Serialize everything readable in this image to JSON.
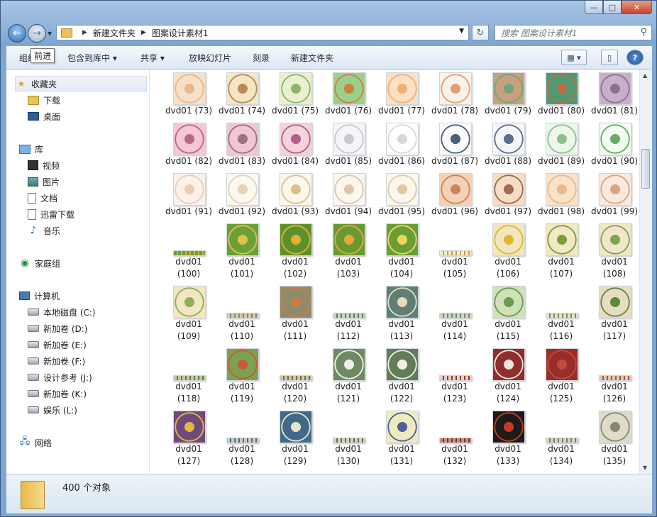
{
  "window": {
    "min_glyph": "—",
    "max_glyph": "□",
    "close_glyph": "✕"
  },
  "nav": {
    "back_glyph": "←",
    "forward_glyph": "→",
    "dropdown_glyph": "▼",
    "breadcrumb": [
      "新建文件夹",
      "图案设计素材1"
    ],
    "refresh_glyph": "↻",
    "search_placeholder": "搜索 图案设计素材1",
    "tooltip": "前进"
  },
  "toolbar": {
    "organize": "组织",
    "include": "包含到库中 ▾",
    "share": "共享 ▾",
    "slideshow": "放映幻灯片",
    "burn": "刻录",
    "new_folder": "新建文件夹"
  },
  "sidebar": {
    "favorites": {
      "label": "收藏夹",
      "items": [
        "下载",
        "桌面"
      ]
    },
    "libraries": {
      "label": "库",
      "items": [
        "视频",
        "图片",
        "文档",
        "迅雷下载",
        "音乐"
      ]
    },
    "homegroup": "家庭组",
    "computer": {
      "label": "计算机",
      "items": [
        "本地磁盘 (C:)",
        "新加卷 (D:)",
        "新加卷 (E:)",
        "新加卷 (F:)",
        "设计参考 (J:)",
        "新加卷 (K:)",
        "娱乐 (L:)"
      ]
    },
    "network": "网络"
  },
  "files": {
    "row1": [
      "dvd01 (73)",
      "dvd01 (74)",
      "dvd01 (75)",
      "dvd01 (76)",
      "dvd01 (77)",
      "dvd01 (78)",
      "dvd01 (79)",
      "dvd01 (80)",
      "dvd01 (81)"
    ],
    "row2": [
      "dvd01 (82)",
      "dvd01 (83)",
      "dvd01 (84)",
      "dvd01 (85)",
      "dvd01 (86)",
      "dvd01 (87)",
      "dvd01 (88)",
      "dvd01 (89)",
      "dvd01 (90)"
    ],
    "row3": [
      "dvd01 (91)",
      "dvd01 (92)",
      "dvd01 (93)",
      "dvd01 (94)",
      "dvd01 (95)",
      "dvd01 (96)",
      "dvd01 (97)",
      "dvd01 (98)",
      "dvd01 (99)"
    ],
    "row4": [
      [
        "dvd01",
        "(100)"
      ],
      [
        "dvd01",
        "(101)"
      ],
      [
        "dvd01",
        "(102)"
      ],
      [
        "dvd01",
        "(103)"
      ],
      [
        "dvd01",
        "(104)"
      ],
      [
        "dvd01",
        "(105)"
      ],
      [
        "dvd01",
        "(106)"
      ],
      [
        "dvd01",
        "(107)"
      ],
      [
        "dvd01",
        "(108)"
      ]
    ],
    "row5": [
      [
        "dvd01",
        "(109)"
      ],
      [
        "dvd01",
        "(110)"
      ],
      [
        "dvd01",
        "(111)"
      ],
      [
        "dvd01",
        "(112)"
      ],
      [
        "dvd01",
        "(113)"
      ],
      [
        "dvd01",
        "(114)"
      ],
      [
        "dvd01",
        "(115)"
      ],
      [
        "dvd01",
        "(116)"
      ],
      [
        "dvd01",
        "(117)"
      ]
    ],
    "row6": [
      [
        "dvd01",
        "(118)"
      ],
      [
        "dvd01",
        "(119)"
      ],
      [
        "dvd01",
        "(120)"
      ],
      [
        "dvd01",
        "(121)"
      ],
      [
        "dvd01",
        "(122)"
      ],
      [
        "dvd01",
        "(123)"
      ],
      [
        "dvd01",
        "(124)"
      ],
      [
        "dvd01",
        "(125)"
      ],
      [
        "dvd01",
        "(126)"
      ]
    ],
    "row7": [
      [
        "dvd01",
        "(127)"
      ],
      [
        "dvd01",
        "(128)"
      ],
      [
        "dvd01",
        "(129)"
      ],
      [
        "dvd01",
        "(130)"
      ],
      [
        "dvd01",
        "(131)"
      ],
      [
        "dvd01",
        "(132)"
      ],
      [
        "dvd01",
        "(133)"
      ],
      [
        "dvd01",
        "(134)"
      ],
      [
        "dvd01",
        "(135)"
      ]
    ]
  },
  "status": {
    "count": "400 个对象"
  }
}
